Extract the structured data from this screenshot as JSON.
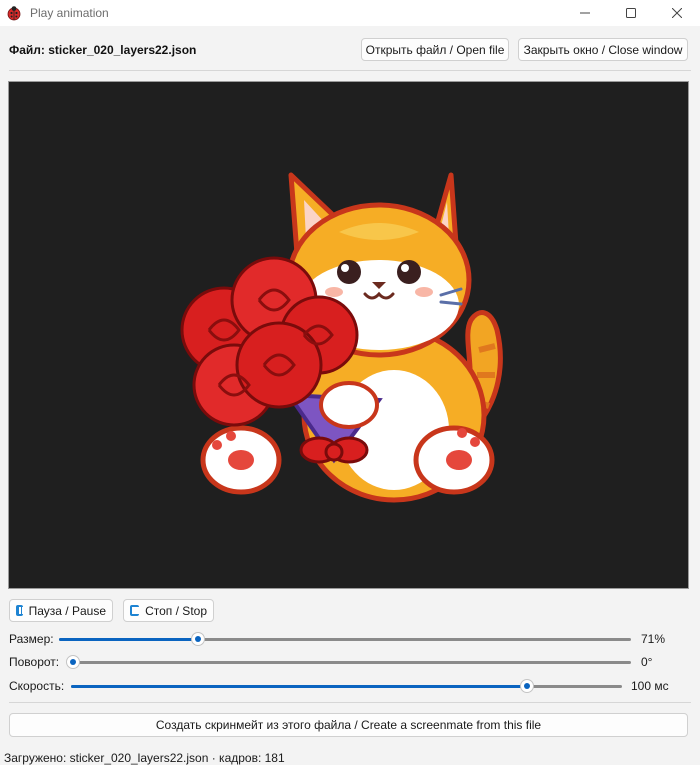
{
  "window": {
    "title": "Play animation"
  },
  "header": {
    "file_label": "Файл: sticker_020_layers22.json",
    "open_button": "Открыть файл / Open file",
    "close_button": "Закрыть окно / Close window"
  },
  "controls": {
    "pause_button": "Пауза / Pause",
    "stop_button": "Стоп / Stop"
  },
  "sliders": [
    {
      "label": "Размер:",
      "value_text": "71%",
      "level": 0.243
    },
    {
      "label": "Поворот:",
      "value_text": "0°",
      "level": 0.0
    },
    {
      "label": "Скорость:",
      "value_text": "100 мс",
      "level": 0.827
    }
  ],
  "create_button": "Создать скринмейт из этого файла / Create a screenmate from this file",
  "status": {
    "text": "Загружено: sticker_020_layers22.json · кадров: 181"
  },
  "colors": {
    "accent": "#0a64c0",
    "canvas_bg": "#1f1f1f",
    "window_bg": "#f3f3f3"
  },
  "icons": {
    "app": "ladybug-icon",
    "pause": "pause-icon",
    "stop": "stop-icon"
  }
}
